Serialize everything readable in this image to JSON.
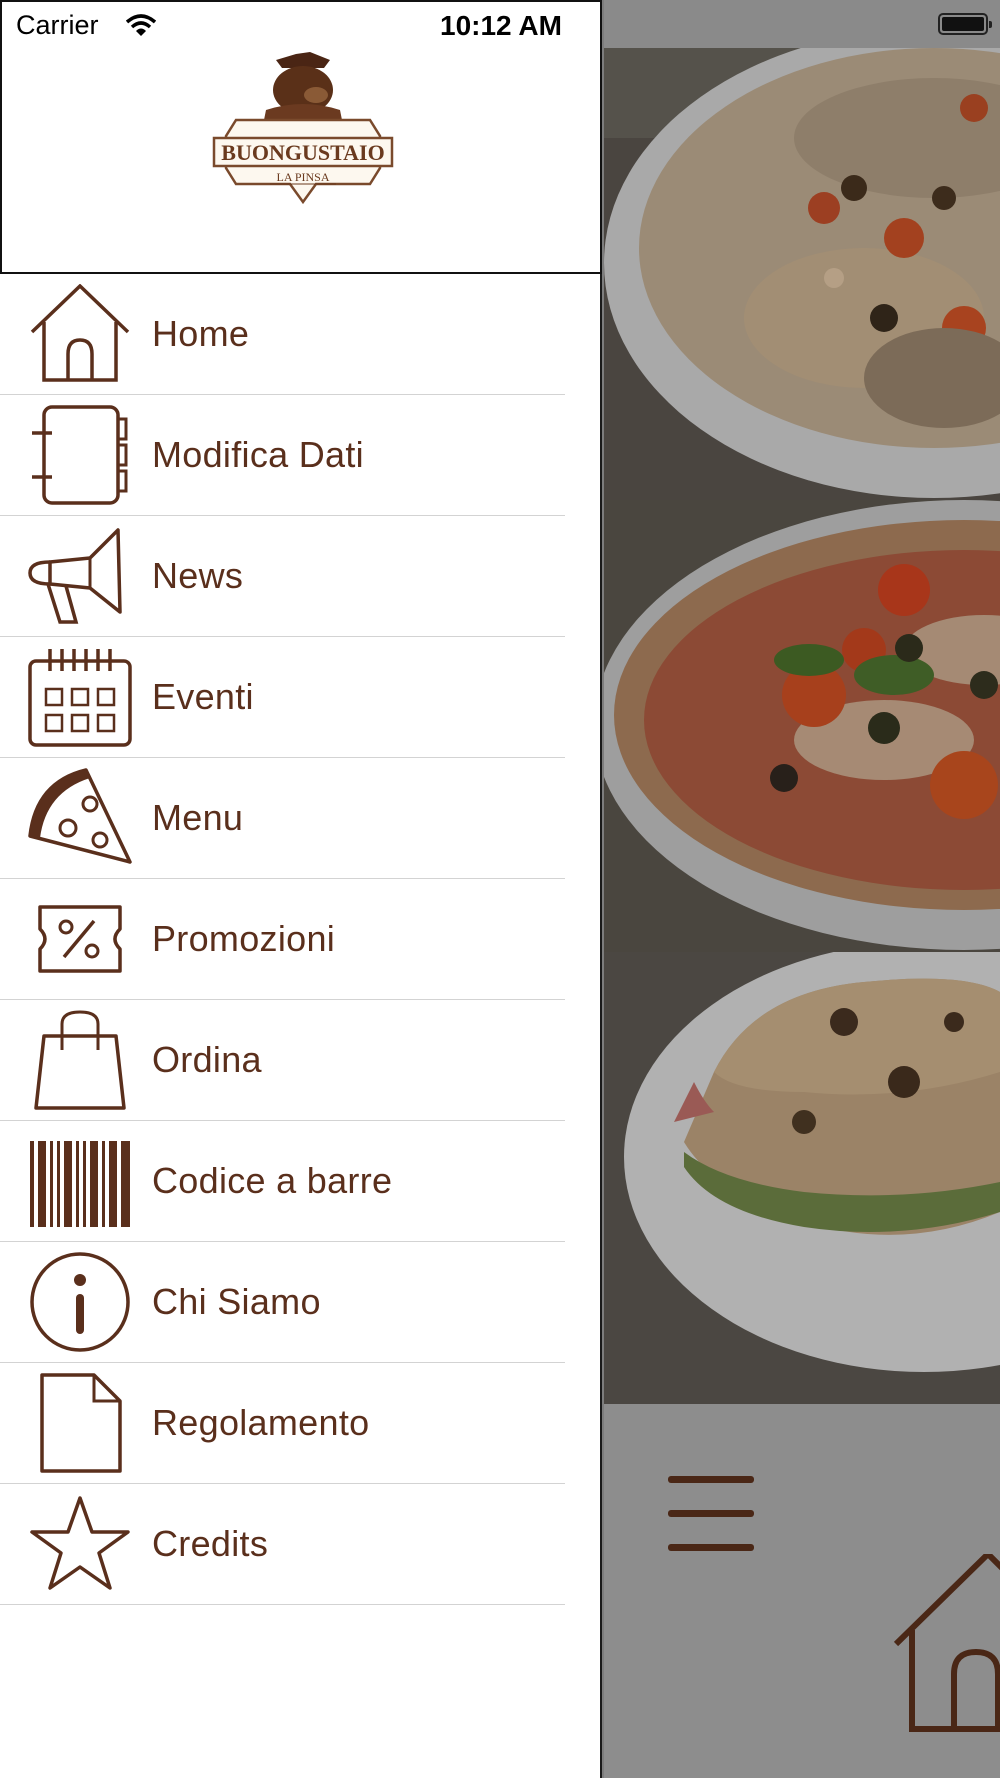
{
  "status_bar": {
    "carrier": "Carrier",
    "time": "10:12 AM"
  },
  "brand": {
    "name": "BUONGUSTAIO",
    "tagline": "LA PINSA"
  },
  "colors": {
    "accent": "#5a2f1c",
    "divider": "#d3d3d3",
    "overlay": "#8b8b8b"
  },
  "menu": {
    "items": [
      {
        "label": "Home",
        "icon": "house-icon"
      },
      {
        "label": "Modifica Dati",
        "icon": "notebook-icon"
      },
      {
        "label": "News",
        "icon": "megaphone-icon"
      },
      {
        "label": "Eventi",
        "icon": "calendar-icon"
      },
      {
        "label": "Menu",
        "icon": "pizza-slice-icon"
      },
      {
        "label": "Promozioni",
        "icon": "percent-ticket-icon"
      },
      {
        "label": "Ordina",
        "icon": "shopping-bag-icon"
      },
      {
        "label": "Codice a barre",
        "icon": "barcode-icon"
      },
      {
        "label": "Chi Siamo",
        "icon": "info-icon"
      },
      {
        "label": "Regolamento",
        "icon": "document-icon"
      },
      {
        "label": "Credits",
        "icon": "star-icon"
      }
    ]
  }
}
